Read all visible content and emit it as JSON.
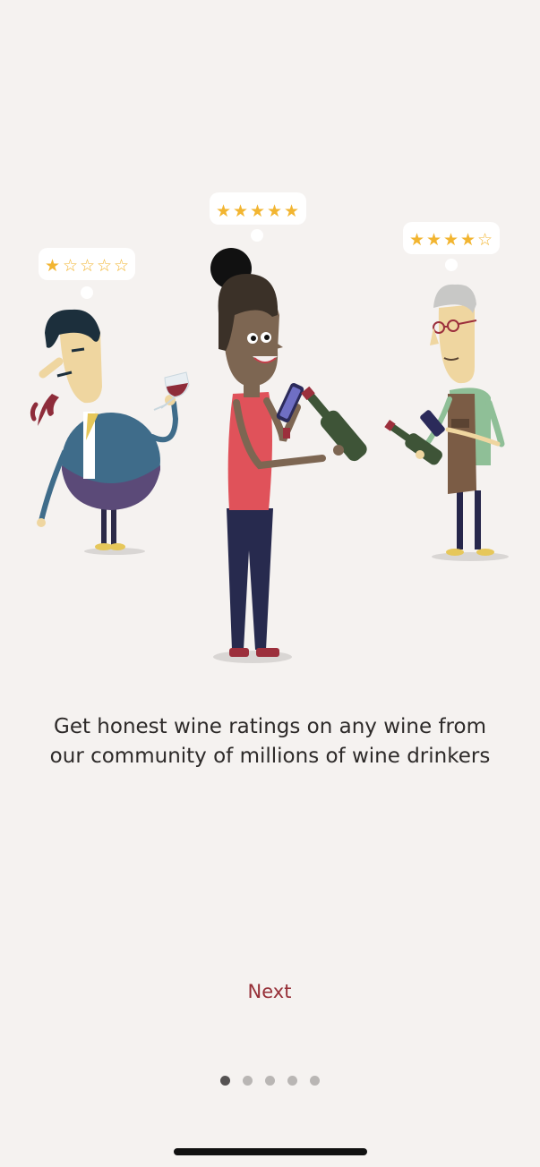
{
  "onboarding": {
    "caption": "Get honest wine ratings on any wine from our community of millions of wine drinkers",
    "next_label": "Next",
    "current_page": 1,
    "total_pages": 5
  },
  "reviewers": [
    {
      "rating": 1,
      "max": 5
    },
    {
      "rating": 5,
      "max": 5
    },
    {
      "rating": 4,
      "max": 5
    }
  ],
  "colors": {
    "background": "#f5f2f0",
    "accent": "#962f37",
    "star": "#f2b531",
    "dot_active": "#555252",
    "dot_inactive": "#b9b6b4"
  },
  "icons": [
    "star-icon",
    "wine-bottle-icon",
    "phone-icon",
    "wine-glass-icon"
  ]
}
